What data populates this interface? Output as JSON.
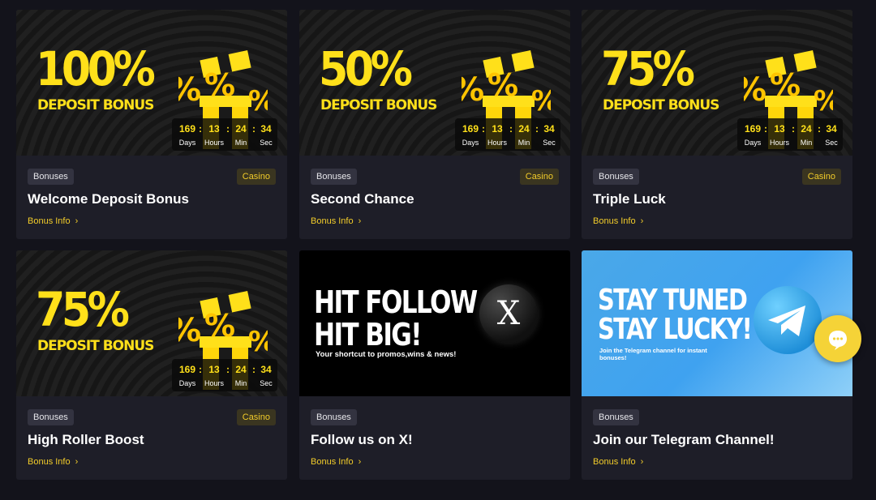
{
  "timer": {
    "days": "169",
    "hours": "13",
    "min": "24",
    "sec": "34",
    "days_label": "Days",
    "hours_label": "Hours",
    "min_label": "Min",
    "sec_label": "Sec"
  },
  "cards": [
    {
      "big": "100%",
      "sub": "DEPOSIT BONUS",
      "tag": "Bonuses",
      "category": "Casino",
      "title": "Welcome Deposit Bonus",
      "info": "Bonus Info"
    },
    {
      "big": "50%",
      "sub": "DEPOSIT BONUS",
      "tag": "Bonuses",
      "category": "Casino",
      "title": "Second Chance",
      "info": "Bonus Info"
    },
    {
      "big": "75%",
      "sub": "DEPOSIT BONUS",
      "tag": "Bonuses",
      "category": "Casino",
      "title": "Triple Luck",
      "info": "Bonus Info"
    },
    {
      "big": "75%",
      "sub": "DEPOSIT BONUS",
      "tag": "Bonuses",
      "category": "Casino",
      "title": "High Roller Boost",
      "info": "Bonus Info"
    },
    {
      "banner_line1": "HIT FOLLOW",
      "banner_line2": "HIT BIG!",
      "banner_sub": "Your shortcut to promos,wins & news!",
      "logo": "X",
      "tag": "Bonuses",
      "title": "Follow us on X!",
      "info": "Bonus Info"
    },
    {
      "banner_line1": "STAY TUNED",
      "banner_line2": "STAY LUCKY!",
      "banner_sub": "Join the Telegram channel for instant bonuses!",
      "tag": "Bonuses",
      "title": "Join our Telegram Channel!",
      "info": "Bonus Info"
    }
  ],
  "icons": {
    "chevron": "chevron-right-icon",
    "chat": "chat-bubble-icon"
  },
  "colors": {
    "background": "#13131b",
    "card": "#1e1e28",
    "accent": "#f2cc2a",
    "banner_yellow": "#ffe01a",
    "chat_button": "#f5d337",
    "telegram": "#3fa2f0"
  }
}
